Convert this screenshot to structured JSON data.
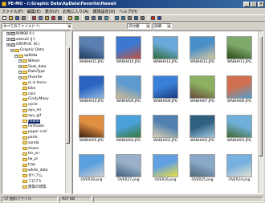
{
  "window": {
    "title": "PE-MU - I:\\Graphic Data\\ApData\\Favorite\\Hawaii"
  },
  "menu": [
    "ファイル(F)",
    "編集(E)",
    "表示(V)",
    "お気に入り(A)",
    "環境設定(O)",
    "ヘルプ(H)"
  ],
  "address": {
    "filter": "すべてのファイル(*.*)",
    "sort": "日付順",
    "view": "詳細"
  },
  "toolbar_icons": [
    "new-icon",
    "open-icon",
    "save-icon",
    "print-icon",
    "cut-icon",
    "copy-icon",
    "paste-icon",
    "delete-icon",
    "undo-icon",
    "up-folder-icon",
    "refresh-icon",
    "thumbnail-icon",
    "details-icon",
    "list-icon",
    "slideshow-icon",
    "rotate-left-icon",
    "rotate-right-icon",
    "zoom-icon",
    "info-icon",
    "settings-icon",
    "close-red-icon",
    "help-icon"
  ],
  "tree": [
    {
      "label": "WIN98 (I:)",
      "kind": "drive",
      "indent": 1
    },
    {
      "label": "adesz2 (J:)",
      "kind": "drive",
      "indent": 1
    },
    {
      "label": "GRAPHIC (K:)",
      "kind": "drive",
      "indent": 1
    },
    {
      "label": "Graphic Data",
      "kind": "folder",
      "indent": 2
    },
    {
      "label": "apData",
      "kind": "folder",
      "indent": 3
    },
    {
      "label": "Wheel",
      "kind": "folder",
      "indent": 4
    },
    {
      "label": "Seat_data",
      "kind": "folder",
      "indent": 4
    },
    {
      "label": "DataType",
      "kind": "folder",
      "indent": 4
    },
    {
      "label": "favorite",
      "kind": "folder",
      "indent": 4
    },
    {
      "label": "ai is horsu",
      "kind": "folder",
      "indent": 5
    },
    {
      "label": "bike",
      "kind": "folder",
      "indent": 5
    },
    {
      "label": "cars",
      "kind": "folder",
      "indent": 5
    },
    {
      "label": "Cindy.Maey",
      "kind": "folder",
      "indent": 5
    },
    {
      "label": "cycle",
      "kind": "folder",
      "indent": 5
    },
    {
      "label": "ayu_eri",
      "kind": "folder",
      "indent": 5
    },
    {
      "label": "ayu_gif",
      "kind": "folder",
      "indent": 5
    },
    {
      "label": "hawaii",
      "kind": "folder",
      "indent": 5,
      "selected": true
    },
    {
      "label": "hirshaski",
      "kind": "folder",
      "indent": 5
    },
    {
      "label": "paper craf",
      "kind": "folder",
      "indent": 5
    },
    {
      "label": "parts",
      "kind": "folder",
      "indent": 5
    },
    {
      "label": "sanda",
      "kind": "folder",
      "indent": 5
    },
    {
      "label": "shoes",
      "kind": "folder",
      "indent": 5
    },
    {
      "label": "tm_on",
      "kind": "folder",
      "indent": 5
    },
    {
      "label": "tw_pl",
      "kind": "folder",
      "indent": 5
    },
    {
      "label": "trap",
      "kind": "folder",
      "indent": 5
    },
    {
      "label": "white_date",
      "kind": "folder",
      "indent": 5
    },
    {
      "label": "ダリアム",
      "kind": "folder",
      "indent": 5
    },
    {
      "label": "フロア1",
      "kind": "folder",
      "indent": 5
    },
    {
      "label": "建築の建築",
      "kind": "folder",
      "indent": 5
    }
  ],
  "thumbnails": [
    {
      "name": "WABHA15.JPG",
      "c1": "#5a7fb0",
      "c2": "#1f3a5c"
    },
    {
      "name": "WABHA14.JPG",
      "c1": "#3d78d0",
      "c2": "#c05040"
    },
    {
      "name": "WABHA13.JPG",
      "c1": "#69a8d8",
      "c2": "#2c6a3a"
    },
    {
      "name": "WABHA12.JPG",
      "c1": "#4a90c8",
      "c2": "#d8c8a0"
    },
    {
      "name": "WABHA11.JPG",
      "c1": "#7fa86a",
      "c2": "#2a4a1a"
    },
    {
      "name": "WABHA10.JPG",
      "c1": "#2a64c0",
      "c2": "#8fb8e0"
    },
    {
      "name": "WABHA09.JPG",
      "c1": "#5c9ad0",
      "c2": "#d0b890"
    },
    {
      "name": "WABHA08.JPG",
      "c1": "#3a80d8",
      "c2": "#1a3a80"
    },
    {
      "name": "WABHA07.JPG",
      "c1": "#8ab060",
      "c2": "#6a4a3a"
    },
    {
      "name": "WABHA06.JPG",
      "c1": "#d07050",
      "c2": "#50a0d0"
    },
    {
      "name": "WABHA05.JPG",
      "c1": "#e09040",
      "c2": "#402010"
    },
    {
      "name": "WABHA04.JPG",
      "c1": "#4aa0d8",
      "c2": "#3a7a3a"
    },
    {
      "name": "WABHA03.JPG",
      "c1": "#5080b0",
      "c2": "#d8d0b0"
    },
    {
      "name": "WABHA02.JPG",
      "c1": "#306080",
      "c2": "#a0c8e0"
    },
    {
      "name": "WABHA01.JPG",
      "c1": "#70b0d8",
      "c2": "#406830"
    },
    {
      "name": "OVER28.png",
      "c1": "#5aa0e0",
      "c2": "#d0d0d0"
    },
    {
      "name": "OVER27.png",
      "c1": "#9ab0c8",
      "c2": "#406080"
    },
    {
      "name": "OVER26.png",
      "c1": "#60a0e0",
      "c2": "#f0e040"
    },
    {
      "name": "OVER25.png",
      "c1": "#88a8c8",
      "c2": "#506878"
    },
    {
      "name": "OVER24.png",
      "c1": "#78b0e0",
      "c2": "#e0e0d0"
    }
  ],
  "status": {
    "count": "37 個のファイル",
    "size": "937 KB"
  }
}
